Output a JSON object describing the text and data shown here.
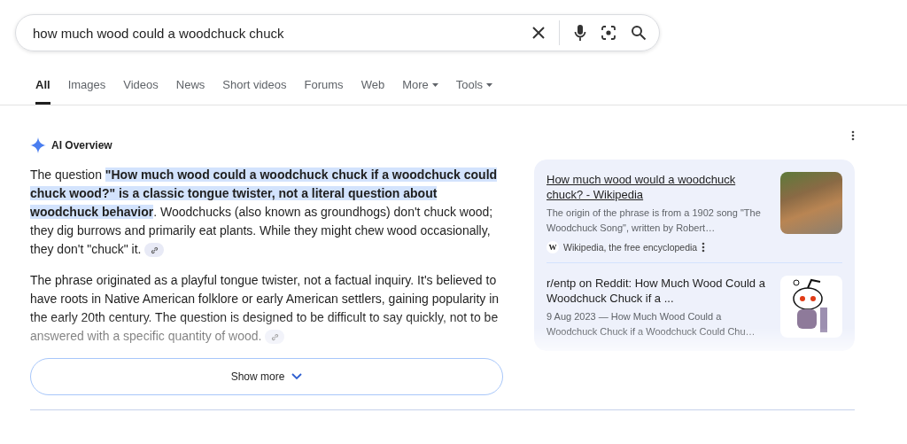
{
  "search": {
    "value": "how much wood could a woodchuck chuck"
  },
  "tabs": [
    {
      "label": "All",
      "selected": true,
      "dropdown": false
    },
    {
      "label": "Images",
      "selected": false,
      "dropdown": false
    },
    {
      "label": "Videos",
      "selected": false,
      "dropdown": false
    },
    {
      "label": "News",
      "selected": false,
      "dropdown": false
    },
    {
      "label": "Short videos",
      "selected": false,
      "dropdown": false
    },
    {
      "label": "Forums",
      "selected": false,
      "dropdown": false
    },
    {
      "label": "Web",
      "selected": false,
      "dropdown": false
    },
    {
      "label": "More",
      "selected": false,
      "dropdown": true
    },
    {
      "label": "Tools",
      "selected": false,
      "dropdown": true
    }
  ],
  "ai_overview": {
    "title": "AI Overview",
    "paragraphs": [
      {
        "faded": false,
        "segments": [
          {
            "text": "The question ",
            "highlighted": false
          },
          {
            "text": "\"How much wood could a woodchuck chuck if a woodchuck could chuck wood?\"  is a classic tongue twister, not a literal question about woodchuck behavior",
            "highlighted": true
          },
          {
            "text": ". Woodchucks (also known as groundhogs) don't chuck wood; they dig burrows and primarily eat plants. While they might chew wood occasionally, they don't \"chuck\" it.",
            "highlighted": false
          }
        ]
      },
      {
        "faded": true,
        "segments": [
          {
            "text": "The phrase originated as a playful tongue twister, not a factual inquiry. It's believed to have roots in Native American folklore or early American settlers, gaining popularity in the early 20th century. The question is designed to be difficult to say quickly, not to be answered with a specific quantity of wood.",
            "highlighted": false
          }
        ]
      }
    ],
    "show_more": "Show more",
    "sources": [
      {
        "title": "How much wood would a woodchuck chuck? - Wikipedia",
        "snippet": "The origin of the phrase is from a 1902 song \"The Woodchuck Song\", written by Robert…",
        "site": "Wikipedia, the free encyclopedia",
        "site_letter": "W",
        "kind": "photo"
      },
      {
        "title": "r/entp on Reddit: How Much Wood Could a Woodchuck Chuck if a ...",
        "snippet": "9 Aug 2023 — How Much Wood Could a Woodchuck Chuck if a Woodchuck Could Chu…",
        "kind": "mascot"
      }
    ]
  }
}
